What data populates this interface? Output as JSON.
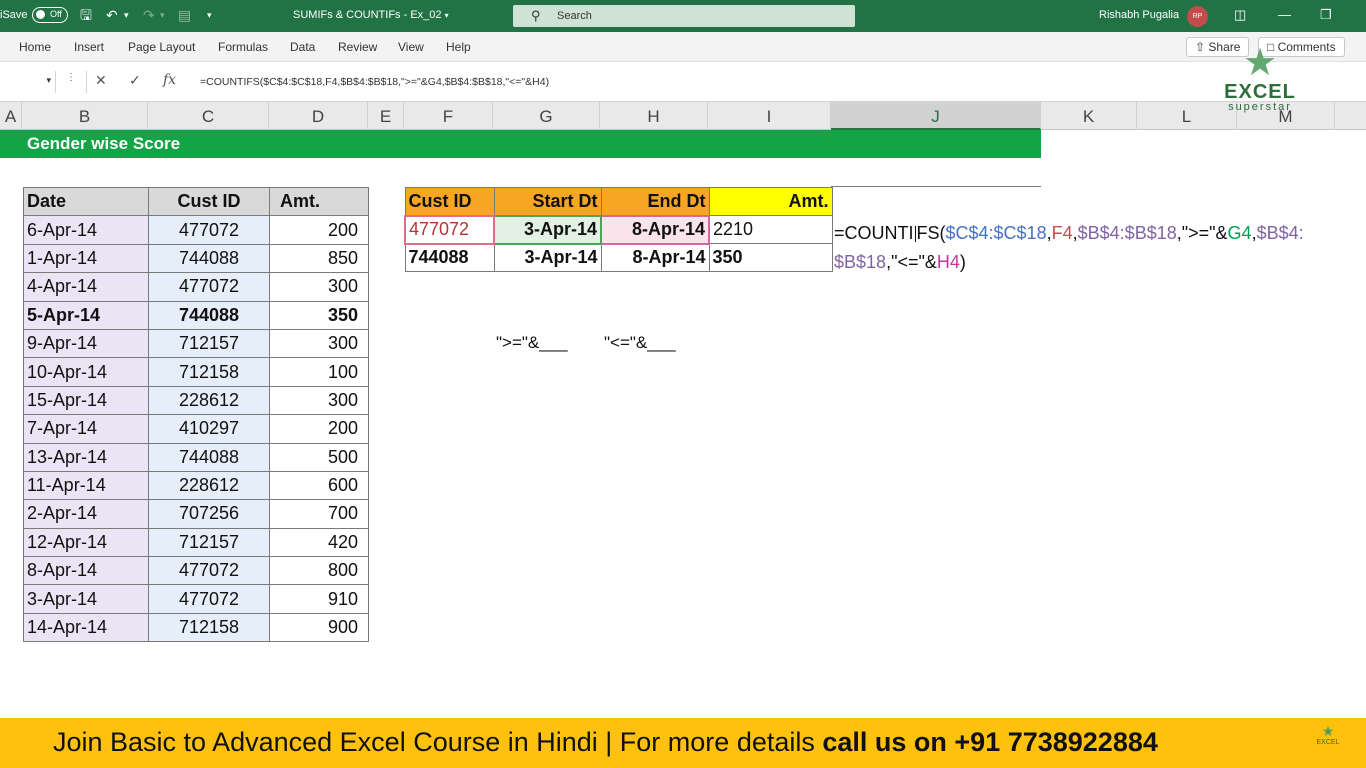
{
  "titlebar": {
    "autosave": "iSave",
    "toggle": "Off",
    "doc_title": "SUMIFs & COUNTIFs - Ex_02",
    "search_placeholder": "Search",
    "user": "Rishabh Pugalia",
    "avatar": "RP"
  },
  "ribbon": {
    "tabs": [
      "Home",
      "Insert",
      "Page Layout",
      "Formulas",
      "Data",
      "Review",
      "View",
      "Help"
    ],
    "share": "Share",
    "comments": "Comments"
  },
  "formula_bar": {
    "formula": "=COUNTIFS($C$4:$C$18,F4,$B$4:$B$18,\">=\"&G4,$B$4:$B$18,\"<=\"&H4)"
  },
  "columns": [
    "A",
    "B",
    "C",
    "D",
    "E",
    "F",
    "G",
    "H",
    "I",
    "J",
    "K",
    "L",
    "M"
  ],
  "sheet": {
    "banner": "Gender wise Score",
    "data_table": {
      "headers": [
        "Date",
        "Cust ID",
        "Amt."
      ],
      "rows": [
        [
          "6-Apr-14",
          "477072",
          "200"
        ],
        [
          "1-Apr-14",
          "744088",
          "850"
        ],
        [
          "4-Apr-14",
          "477072",
          "300"
        ],
        [
          "5-Apr-14",
          "744088",
          "350"
        ],
        [
          "9-Apr-14",
          "712157",
          "300"
        ],
        [
          "10-Apr-14",
          "712158",
          "100"
        ],
        [
          "15-Apr-14",
          "228612",
          "300"
        ],
        [
          "7-Apr-14",
          "410297",
          "200"
        ],
        [
          "13-Apr-14",
          "744088",
          "500"
        ],
        [
          "11-Apr-14",
          "228612",
          "600"
        ],
        [
          "2-Apr-14",
          "707256",
          "700"
        ],
        [
          "12-Apr-14",
          "712157",
          "420"
        ],
        [
          "8-Apr-14",
          "477072",
          "800"
        ],
        [
          "3-Apr-14",
          "477072",
          "910"
        ],
        [
          "14-Apr-14",
          "712158",
          "900"
        ]
      ]
    },
    "criteria_table": {
      "headers": [
        "Cust ID",
        "Start Dt",
        "End Dt",
        "Amt."
      ],
      "rows": [
        [
          "477072",
          "3-Apr-14",
          "8-Apr-14",
          "2210"
        ],
        [
          "744088",
          "3-Apr-14",
          "8-Apr-14",
          "350"
        ]
      ]
    },
    "formula_parts": {
      "p1": "=COUNTI",
      "p2": "FS(",
      "c_range": "$C$4:$C$18",
      "comma1": ",",
      "f_ref": "F4",
      "comma2": ",",
      "b_range1": "$B$4:$B$18",
      "gte": ",\">=\"&",
      "g_ref": "G4",
      "comma3": ",",
      "b_range2a": "$B$4:",
      "b_range2b": "$B$18",
      "lte": ",\"<=\"&",
      "h_ref": "H4",
      "close": ")"
    },
    "note_gte": "\">=\"&___",
    "note_lte": "\"<=\"&___"
  },
  "logo": {
    "excel": "EXCEL",
    "superstar": "superstar"
  },
  "footer": {
    "text": "Join Basic to Advanced Excel Course in Hindi | For more details ",
    "bold": "call us on +91 7738922884",
    "minilogo": "EXCEL"
  },
  "colors": {
    "excel_green": "#217346",
    "banner_green": "#14a447",
    "footer_yellow": "#fec10e",
    "header_orange": "#f6a623",
    "header_yellow": "#ffff00"
  }
}
